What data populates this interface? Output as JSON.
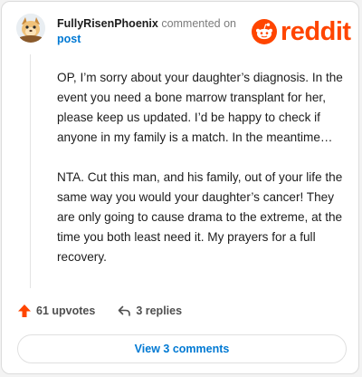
{
  "comment": {
    "author": "FullyRisenPhoenix",
    "action_text": " commented on",
    "post_link": "post",
    "paragraphs": [
      "OP, I’m sorry about your daughter’s diagnosis. In the event you need a bone marrow transplant for her, please keep us updated. I’d be happy to check if anyone in my family is a match. In the meantime…",
      "NTA. Cut this man, and his family, out of your life the same way you would your daughter’s cancer! They are only going to cause drama to the extreme, at the time you both least need it. My prayers for a full recovery."
    ]
  },
  "brand": {
    "logo_text": "reddit",
    "color": "#ff4500"
  },
  "footer": {
    "upvotes": "61 upvotes",
    "replies": "3 replies"
  },
  "view_button": {
    "label": "View 3 comments"
  }
}
